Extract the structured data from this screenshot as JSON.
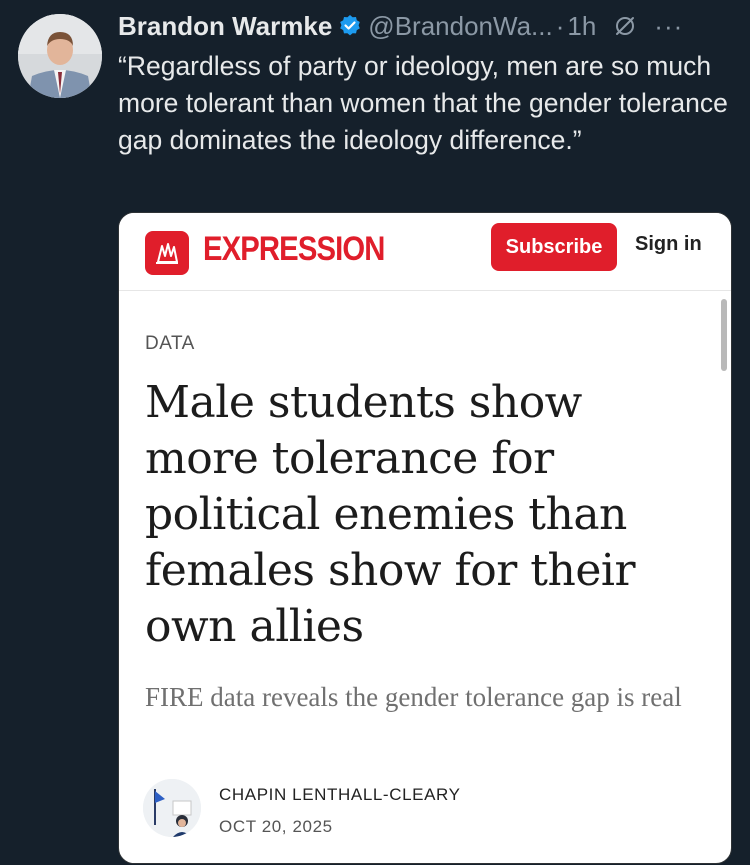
{
  "tweet": {
    "display_name": "Brandon Warmke",
    "handle": "@BrandonWa...",
    "separator": "·",
    "time": "1h",
    "more": "···",
    "text": "“Regardless of party or ideology, men are so much more tolerant than women that the gender tolerance gap dominates the ideology difference.”",
    "verified_color": "#1d9bf0",
    "icons": [
      "verified-badge-icon",
      "grok-icon",
      "more-icon"
    ]
  },
  "card": {
    "brand_name": "EXPRESSION",
    "brand_color": "#e01e2b",
    "subscribe_label": "Subscribe",
    "signin_label": "Sign in",
    "category": "DATA",
    "headline": "Male students show more tolerance for political enemies than females show for their own allies",
    "subheadline": "FIRE data reveals the gender tolerance gap is real",
    "author_name": "CHAPIN LENTHALL-CLEARY",
    "date": "OCT 20, 2025"
  }
}
